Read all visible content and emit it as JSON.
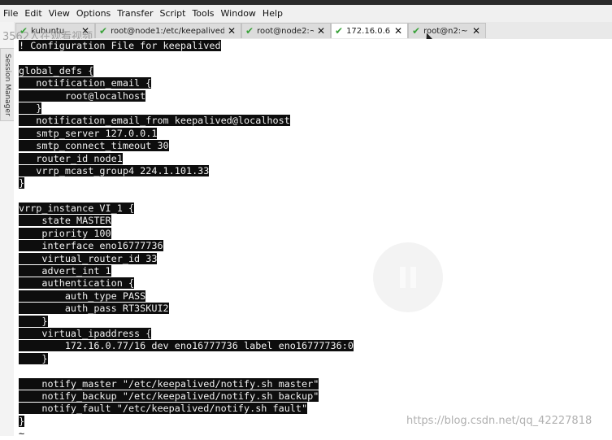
{
  "menu": [
    "File",
    "Edit",
    "View",
    "Options",
    "Transfer",
    "Script",
    "Tools",
    "Window",
    "Help"
  ],
  "sidebar": {
    "label": "Session Manager"
  },
  "tabs": [
    {
      "label": "kubuntu",
      "active": false
    },
    {
      "label": "root@node1:/etc/keepalived",
      "active": false
    },
    {
      "label": "root@node2:~",
      "active": false
    },
    {
      "label": "172.16.0.6",
      "active": true
    },
    {
      "label": "root@n2:~",
      "active": false
    }
  ],
  "watermarks": {
    "top": "3562人在观看视频",
    "bottom": "https://blog.csdn.net/qq_42227818"
  },
  "terminal": {
    "lines": [
      {
        "text": "! Configuration File for keepalived",
        "hl": true
      },
      {
        "text": "",
        "hl": false
      },
      {
        "text": "global_defs {",
        "hl": true
      },
      {
        "text": "   notification_email {",
        "hl": true
      },
      {
        "text": "        root@localhost",
        "hl": true
      },
      {
        "text": "   }",
        "hl": true
      },
      {
        "text": "   notification_email_from keepalived@localhost",
        "hl": true
      },
      {
        "text": "   smtp_server 127.0.0.1",
        "hl": true
      },
      {
        "text": "   smtp_connect_timeout 30",
        "hl": true
      },
      {
        "text": "   router_id node1",
        "hl": true
      },
      {
        "text": "   vrrp_mcast_group4 224.1.101.33",
        "hl": true
      },
      {
        "text": "}",
        "hl": true
      },
      {
        "text": "",
        "hl": false
      },
      {
        "text": "vrrp_instance VI_1 {",
        "hl": true
      },
      {
        "text": "    state MASTER",
        "hl": true
      },
      {
        "text": "    priority 100",
        "hl": true
      },
      {
        "text": "    interface eno16777736",
        "hl": true
      },
      {
        "text": "    virtual_router_id 33",
        "hl": true
      },
      {
        "text": "    advert_int 1",
        "hl": true
      },
      {
        "text": "    authentication {",
        "hl": true
      },
      {
        "text": "        auth_type PASS",
        "hl": true
      },
      {
        "text": "        auth_pass RT3SKUI2",
        "hl": true
      },
      {
        "text": "    }",
        "hl": true
      },
      {
        "text": "    virtual_ipaddress {",
        "hl": true
      },
      {
        "text": "        172.16.0.77/16 dev eno16777736 label eno16777736:0",
        "hl": true
      },
      {
        "text": "    }",
        "hl": true
      },
      {
        "text": "",
        "hl": false
      },
      {
        "text": "    notify_master \"/etc/keepalived/notify.sh master\"",
        "hl": true
      },
      {
        "text": "    notify_backup \"/etc/keepalived/notify.sh backup\"",
        "hl": true
      },
      {
        "text": "    notify_fault \"/etc/keepalived/notify.sh fault\"",
        "hl": true
      },
      {
        "text": "}",
        "hl": true
      },
      {
        "text": "~",
        "hl": false
      }
    ]
  },
  "colors": {
    "selection_bg": "#0d0d0d",
    "selection_fg": "#f2f2f2",
    "check": "#3aa23a"
  }
}
